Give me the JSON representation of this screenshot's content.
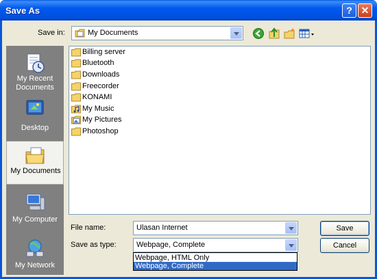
{
  "window": {
    "title": "Save As",
    "help_glyph": "?",
    "close_glyph": "✕"
  },
  "toolbar": {
    "save_in_label": "Save in:",
    "location": "My Documents",
    "icons": [
      "back-icon",
      "up-folder-icon",
      "new-folder-icon",
      "views-menu-icon"
    ]
  },
  "places": [
    {
      "label": "My Recent Documents",
      "icon": "recent-documents-icon"
    },
    {
      "label": "Desktop",
      "icon": "desktop-icon"
    },
    {
      "label": "My Documents",
      "icon": "my-documents-icon",
      "selected": true
    },
    {
      "label": "My Computer",
      "icon": "my-computer-icon"
    },
    {
      "label": "My Network",
      "icon": "my-network-icon"
    }
  ],
  "files": [
    {
      "name": "Billing server",
      "icon": "folder-icon"
    },
    {
      "name": "Bluetooth",
      "icon": "folder-icon"
    },
    {
      "name": "Downloads",
      "icon": "folder-icon"
    },
    {
      "name": "Freecorder",
      "icon": "folder-icon"
    },
    {
      "name": "KONAMI",
      "icon": "folder-icon"
    },
    {
      "name": "My Music",
      "icon": "music-folder-icon"
    },
    {
      "name": "My Pictures",
      "icon": "pictures-folder-icon"
    },
    {
      "name": "Photoshop",
      "icon": "folder-icon"
    }
  ],
  "form": {
    "file_name_label": "File name:",
    "file_name_value": "Ulasan Internet",
    "save_type_label": "Save as type:",
    "save_type_value": "Webpage, Complete",
    "save_type_options": [
      {
        "label": "Webpage, HTML Only",
        "selected": false
      },
      {
        "label": "Webpage, Complete",
        "selected": true
      }
    ]
  },
  "buttons": {
    "save": "Save",
    "cancel": "Cancel"
  },
  "colors": {
    "title_bar": "#0054e3",
    "dialog_bg": "#ece9d8",
    "places_bg": "#808080",
    "selection": "#316ac5",
    "folder": "#f5d36b"
  }
}
